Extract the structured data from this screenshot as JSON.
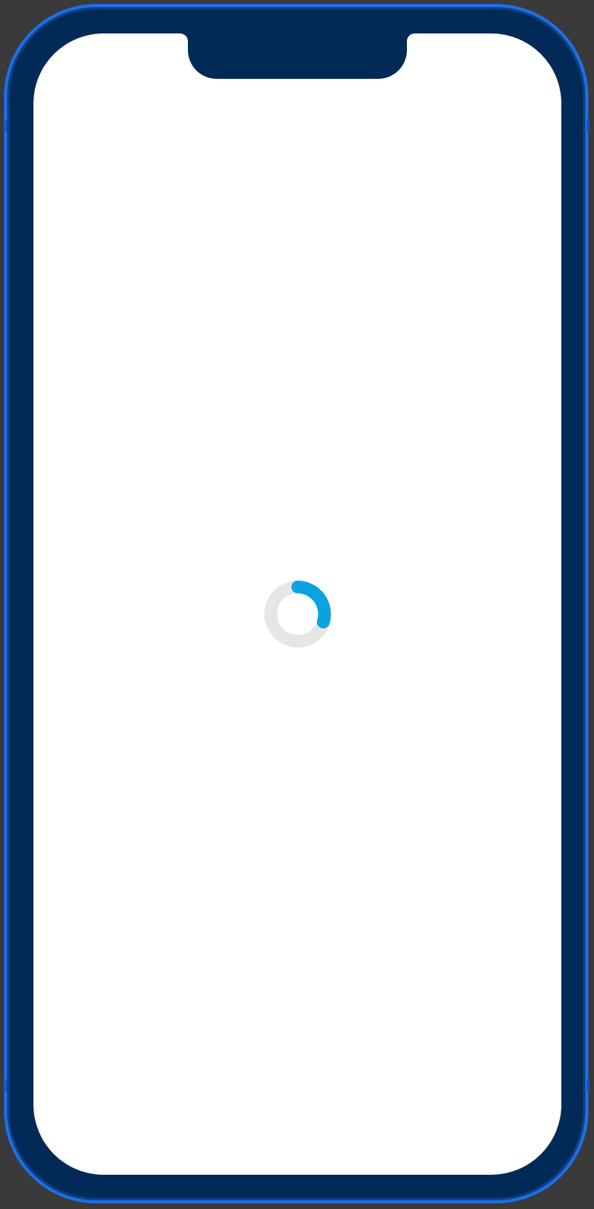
{
  "colors": {
    "frame": "#012a56",
    "frame_edge": "#1f6fe0",
    "screen": "#ffffff",
    "spinner_track": "#e6e6e6",
    "spinner_arc": "#0aa3df"
  },
  "loading": {
    "icon": "loading-spinner-icon",
    "label": ""
  }
}
